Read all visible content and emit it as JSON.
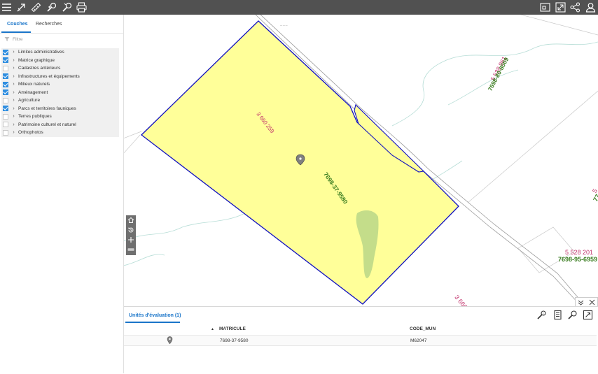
{
  "toolbar": {
    "left_icons": [
      "menu-icon",
      "measure-arrow-icon",
      "ruler-icon",
      "identify-icon",
      "edit-identify-icon",
      "print-icon"
    ],
    "right_icons": [
      "legend-icon",
      "fullscreen-icon",
      "share-icon",
      "user-icon"
    ]
  },
  "sidebar": {
    "tabs": [
      "Couches",
      "Recherches"
    ],
    "filter_placeholder": "Filtre",
    "layers": [
      {
        "label": "Limites administratives",
        "checked": true
      },
      {
        "label": "Matrice graphique",
        "checked": true
      },
      {
        "label": "Cadastres antérieurs",
        "checked": false
      },
      {
        "label": "Infrastructures et équipements",
        "checked": true
      },
      {
        "label": "Milieux naturels",
        "checked": true
      },
      {
        "label": "Aménagement",
        "checked": true
      },
      {
        "label": "Agriculture",
        "checked": false
      },
      {
        "label": "Parcs et territoires fauniques",
        "checked": true
      },
      {
        "label": "Terres publiques",
        "checked": false
      },
      {
        "label": "Patrimoine culturel et naturel",
        "checked": false
      },
      {
        "label": "Orthophotos",
        "checked": false
      }
    ]
  },
  "map": {
    "parcel_fill": "#ffff99",
    "parcel_stroke": "#1010c0",
    "lot_color": "#c0306a",
    "matricule_color": "#3a7d20",
    "labels": {
      "parcel_lot": "3 660 259",
      "parcel_matricule": "7698-37-9580",
      "ne_lot": "5 538 961",
      "ne_matricule": "7698-80-8009",
      "e_lot": "5 528 201",
      "e_matricule": "7698-95-6959",
      "se_lot_partial": "3 660",
      "edge_lot_partial": "5",
      "edge_mat_partial": "77"
    }
  },
  "bottom_panel": {
    "tab": "Unités d'évaluation (1)",
    "sort_indicator": "▲",
    "columns": [
      "MATRICULE",
      "CODE_MUN"
    ],
    "rows": [
      {
        "matricule": "7698-37-9580",
        "code_mun": "M62047"
      }
    ]
  }
}
